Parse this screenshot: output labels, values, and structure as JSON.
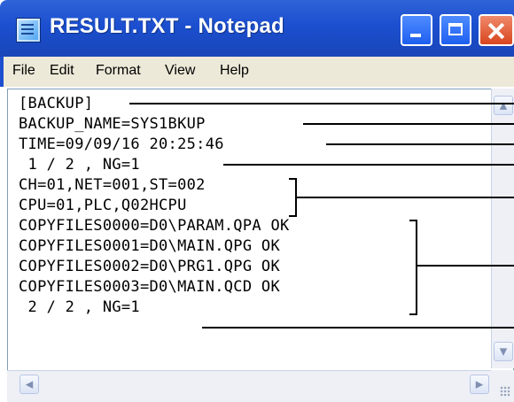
{
  "window": {
    "title": "RESULT.TXT - Notepad"
  },
  "menu": [
    "File",
    "Edit",
    "Format",
    "View",
    "Help"
  ],
  "lines": [
    "[BACKUP]",
    "BACKUP_NAME=SYS1BKUP",
    "TIME=09/09/16 20:25:46",
    " 1 / 2 , NG=1",
    "CH=01,NET=001,ST=002",
    "CPU=01,PLC,Q02HCPU",
    "COPYFILES0000=D0\\PARAM.QPA OK",
    "COPYFILES0001=D0\\MAIN.QPG OK",
    "COPYFILES0002=D0\\PRG1.QPG OK",
    "COPYFILES0003=D0\\MAIN.QCD OK",
    " 2 / 2 , NG=1"
  ],
  "icons": {
    "app": "notepad-icon",
    "minimize": "minimize-icon",
    "maximize": "maximize-icon",
    "close": "close-icon",
    "scroll_up": "arrow-up-icon",
    "scroll_down": "arrow-down-icon",
    "scroll_left": "arrow-left-icon",
    "scroll_right": "arrow-right-icon",
    "resize": "resize-grip-icon"
  },
  "colors": {
    "titlebar": "#1b4fcf",
    "close_button": "#d8451f",
    "menubar": "#ece9d8"
  }
}
